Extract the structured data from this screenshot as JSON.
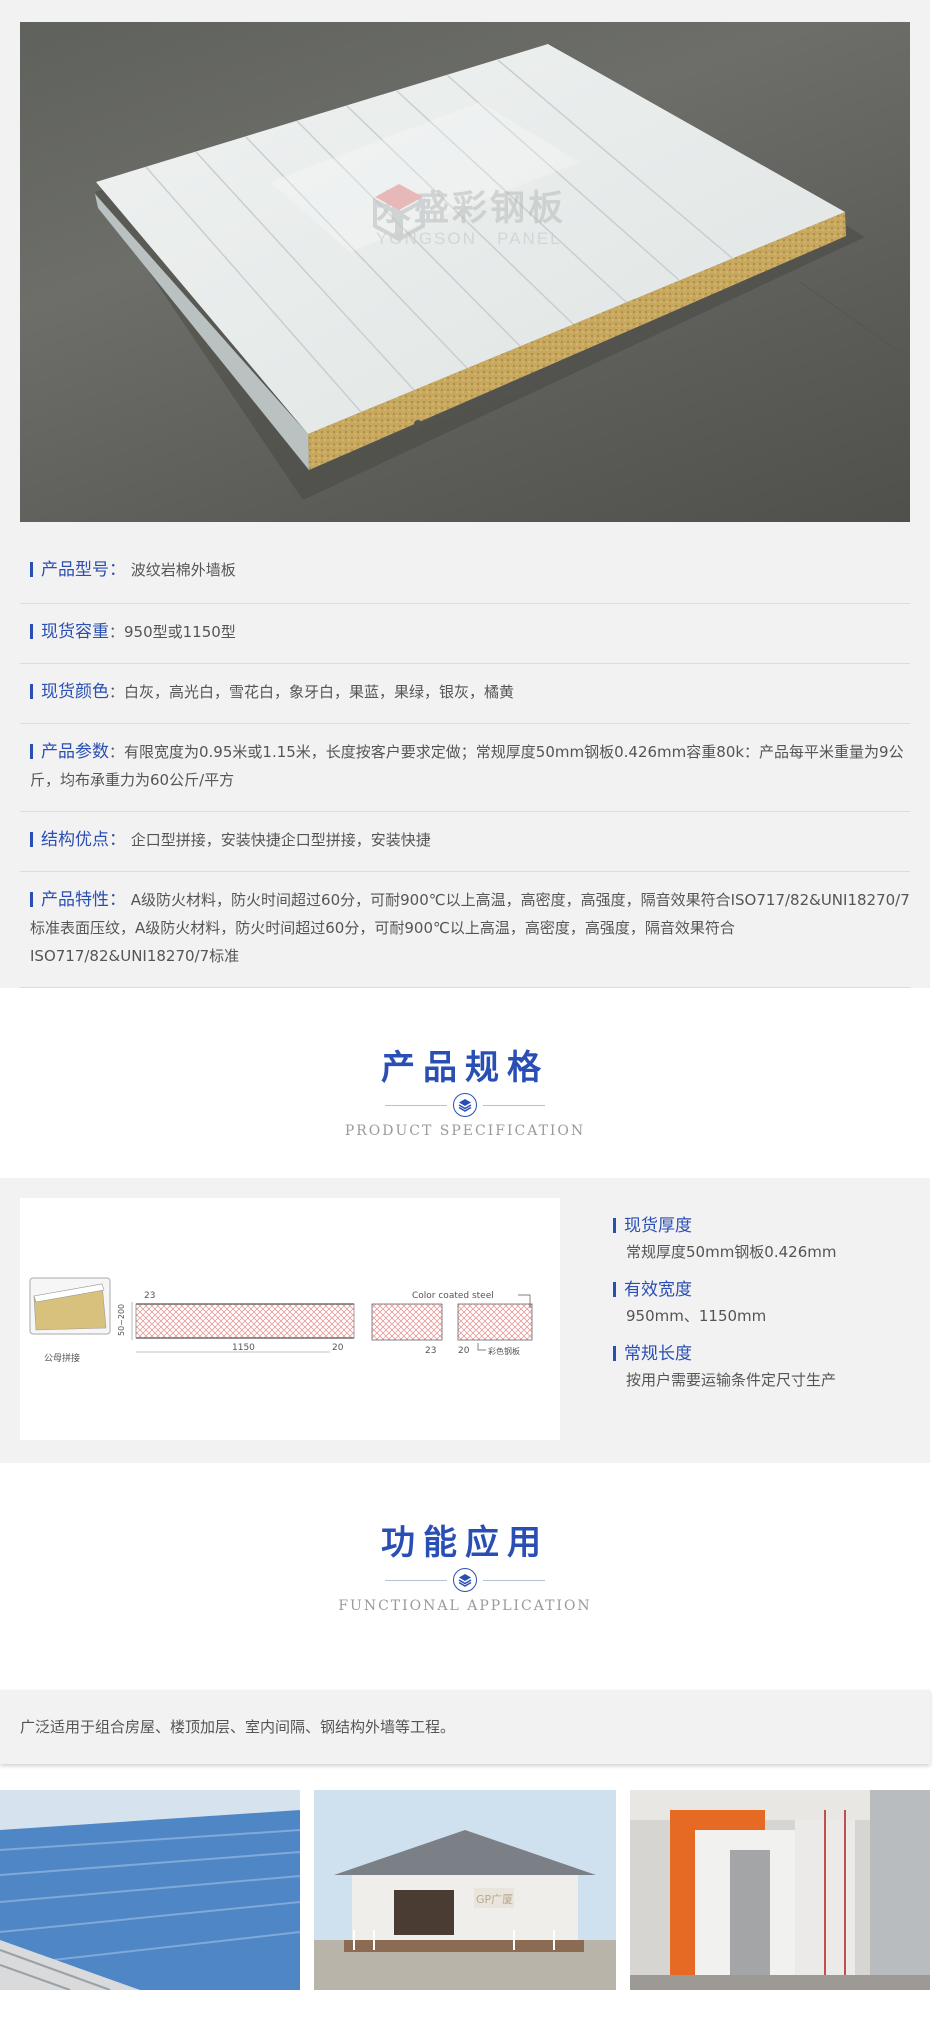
{
  "hero": {
    "watermark_cn": "永盛彩钢板",
    "watermark_en": "YONGSON   PANEL"
  },
  "attributes": [
    {
      "label": "产品型号：",
      "value": "波纹岩棉外墙板"
    },
    {
      "label": "现货容重",
      "value": "：950型或1150型"
    },
    {
      "label": "现货颜色",
      "value": "：白灰，高光白，雪花白，象牙白，果蓝，果绿，银灰，橘黄"
    },
    {
      "label": "产品参数",
      "value": "：有限宽度为0.95米或1.15米，长度按客户要求定做；常规厚度50mm钢板0.426mm容重80k：产品每平米重量为9公斤，均布承重力为60公斤/平方"
    },
    {
      "label": "结构优点：",
      "value": "企口型拼接，安装快捷企口型拼接，安装快捷"
    },
    {
      "label": "产品特性：",
      "value": "A级防火材料，防火时间超过60分，可耐900℃以上高温，高密度，高强度，隔音效果符合ISO717/82&UNI18270/7标准表面压纹，A级防火材料，防火时间超过60分，可耐900℃以上高温，高密度，高强度，隔音效果符合ISO717/82&UNI18270/7标准"
    }
  ],
  "spec_section": {
    "title_cn": "产品规格",
    "title_en": "PRODUCT SPECIFICATION"
  },
  "diagram": {
    "label_joint": "公母拼接",
    "dim_23_a": "23",
    "dim_range": "50~200",
    "dim_1150": "1150",
    "dim_20_a": "20",
    "dim_23_b": "23",
    "dim_20_b": "20",
    "color_coated": "Color coated steel",
    "color_steel_cn": "彩色钢板"
  },
  "specs": [
    {
      "label": "现货厚度",
      "value": "常规厚度50mm钢板0.426mm"
    },
    {
      "label": "有效宽度",
      "value": "950mm、1150mm"
    },
    {
      "label": "常规长度",
      "value": "按用户需要运输条件定尺寸生产"
    }
  ],
  "app_section": {
    "title_cn": "功能应用",
    "title_en": "FUNCTIONAL APPLICATION",
    "description": "广泛适用于组合房屋、楼顶加层、室内间隔、钢结构外墙等工程。"
  },
  "photos": {
    "house_sign": "GP广厦"
  },
  "colors": {
    "accent": "#2a4fb4",
    "section_bg": "#f2f2f2",
    "text": "#555555"
  }
}
